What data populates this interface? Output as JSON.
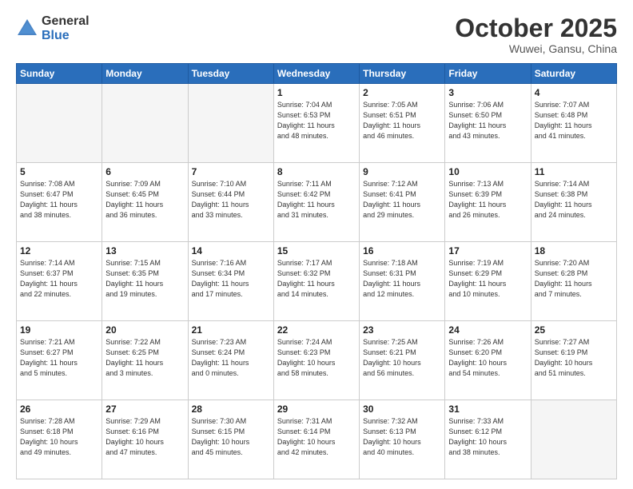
{
  "header": {
    "logo_general": "General",
    "logo_blue": "Blue",
    "title": "October 2025",
    "location": "Wuwei, Gansu, China"
  },
  "days_of_week": [
    "Sunday",
    "Monday",
    "Tuesday",
    "Wednesday",
    "Thursday",
    "Friday",
    "Saturday"
  ],
  "weeks": [
    [
      {
        "day": "",
        "empty": true,
        "info": ""
      },
      {
        "day": "",
        "empty": true,
        "info": ""
      },
      {
        "day": "",
        "empty": true,
        "info": ""
      },
      {
        "day": "1",
        "info": "Sunrise: 7:04 AM\nSunset: 6:53 PM\nDaylight: 11 hours\nand 48 minutes."
      },
      {
        "day": "2",
        "info": "Sunrise: 7:05 AM\nSunset: 6:51 PM\nDaylight: 11 hours\nand 46 minutes."
      },
      {
        "day": "3",
        "info": "Sunrise: 7:06 AM\nSunset: 6:50 PM\nDaylight: 11 hours\nand 43 minutes."
      },
      {
        "day": "4",
        "info": "Sunrise: 7:07 AM\nSunset: 6:48 PM\nDaylight: 11 hours\nand 41 minutes."
      }
    ],
    [
      {
        "day": "5",
        "info": "Sunrise: 7:08 AM\nSunset: 6:47 PM\nDaylight: 11 hours\nand 38 minutes."
      },
      {
        "day": "6",
        "info": "Sunrise: 7:09 AM\nSunset: 6:45 PM\nDaylight: 11 hours\nand 36 minutes."
      },
      {
        "day": "7",
        "info": "Sunrise: 7:10 AM\nSunset: 6:44 PM\nDaylight: 11 hours\nand 33 minutes."
      },
      {
        "day": "8",
        "info": "Sunrise: 7:11 AM\nSunset: 6:42 PM\nDaylight: 11 hours\nand 31 minutes."
      },
      {
        "day": "9",
        "info": "Sunrise: 7:12 AM\nSunset: 6:41 PM\nDaylight: 11 hours\nand 29 minutes."
      },
      {
        "day": "10",
        "info": "Sunrise: 7:13 AM\nSunset: 6:39 PM\nDaylight: 11 hours\nand 26 minutes."
      },
      {
        "day": "11",
        "info": "Sunrise: 7:14 AM\nSunset: 6:38 PM\nDaylight: 11 hours\nand 24 minutes."
      }
    ],
    [
      {
        "day": "12",
        "info": "Sunrise: 7:14 AM\nSunset: 6:37 PM\nDaylight: 11 hours\nand 22 minutes."
      },
      {
        "day": "13",
        "info": "Sunrise: 7:15 AM\nSunset: 6:35 PM\nDaylight: 11 hours\nand 19 minutes."
      },
      {
        "day": "14",
        "info": "Sunrise: 7:16 AM\nSunset: 6:34 PM\nDaylight: 11 hours\nand 17 minutes."
      },
      {
        "day": "15",
        "info": "Sunrise: 7:17 AM\nSunset: 6:32 PM\nDaylight: 11 hours\nand 14 minutes."
      },
      {
        "day": "16",
        "info": "Sunrise: 7:18 AM\nSunset: 6:31 PM\nDaylight: 11 hours\nand 12 minutes."
      },
      {
        "day": "17",
        "info": "Sunrise: 7:19 AM\nSunset: 6:29 PM\nDaylight: 11 hours\nand 10 minutes."
      },
      {
        "day": "18",
        "info": "Sunrise: 7:20 AM\nSunset: 6:28 PM\nDaylight: 11 hours\nand 7 minutes."
      }
    ],
    [
      {
        "day": "19",
        "info": "Sunrise: 7:21 AM\nSunset: 6:27 PM\nDaylight: 11 hours\nand 5 minutes."
      },
      {
        "day": "20",
        "info": "Sunrise: 7:22 AM\nSunset: 6:25 PM\nDaylight: 11 hours\nand 3 minutes."
      },
      {
        "day": "21",
        "info": "Sunrise: 7:23 AM\nSunset: 6:24 PM\nDaylight: 11 hours\nand 0 minutes."
      },
      {
        "day": "22",
        "info": "Sunrise: 7:24 AM\nSunset: 6:23 PM\nDaylight: 10 hours\nand 58 minutes."
      },
      {
        "day": "23",
        "info": "Sunrise: 7:25 AM\nSunset: 6:21 PM\nDaylight: 10 hours\nand 56 minutes."
      },
      {
        "day": "24",
        "info": "Sunrise: 7:26 AM\nSunset: 6:20 PM\nDaylight: 10 hours\nand 54 minutes."
      },
      {
        "day": "25",
        "info": "Sunrise: 7:27 AM\nSunset: 6:19 PM\nDaylight: 10 hours\nand 51 minutes."
      }
    ],
    [
      {
        "day": "26",
        "info": "Sunrise: 7:28 AM\nSunset: 6:18 PM\nDaylight: 10 hours\nand 49 minutes."
      },
      {
        "day": "27",
        "info": "Sunrise: 7:29 AM\nSunset: 6:16 PM\nDaylight: 10 hours\nand 47 minutes."
      },
      {
        "day": "28",
        "info": "Sunrise: 7:30 AM\nSunset: 6:15 PM\nDaylight: 10 hours\nand 45 minutes."
      },
      {
        "day": "29",
        "info": "Sunrise: 7:31 AM\nSunset: 6:14 PM\nDaylight: 10 hours\nand 42 minutes."
      },
      {
        "day": "30",
        "info": "Sunrise: 7:32 AM\nSunset: 6:13 PM\nDaylight: 10 hours\nand 40 minutes."
      },
      {
        "day": "31",
        "info": "Sunrise: 7:33 AM\nSunset: 6:12 PM\nDaylight: 10 hours\nand 38 minutes."
      },
      {
        "day": "",
        "empty": true,
        "info": ""
      }
    ]
  ]
}
